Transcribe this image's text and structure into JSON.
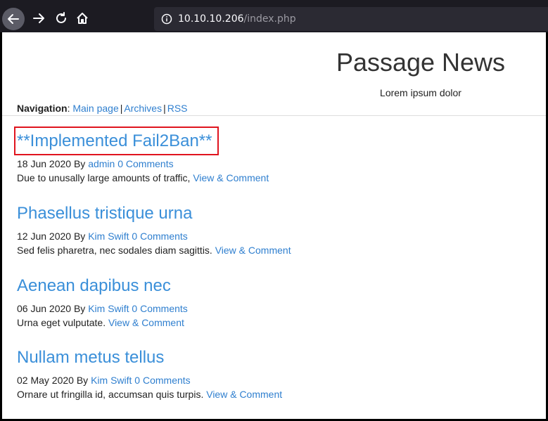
{
  "browser": {
    "url_host": "10.10.10.206",
    "url_path": "/index.php"
  },
  "site": {
    "title": "Passage News",
    "subtitle": "Lorem ipsum dolor",
    "nav_label": "Navigation",
    "nav_links": [
      "Main page",
      "Archives",
      "RSS"
    ]
  },
  "posts": [
    {
      "title": "**Implemented Fail2Ban**",
      "date": "18 Jun 2020 By",
      "author": "admin",
      "comments": "0 Comments",
      "excerpt": "Due to unusally large amounts of traffic,",
      "link": "View & Comment"
    },
    {
      "title": "Phasellus tristique urna",
      "date": "12 Jun 2020 By",
      "author": "Kim Swift",
      "comments": "0 Comments",
      "excerpt": "Sed felis pharetra, nec sodales diam sagittis.",
      "link": "View & Comment"
    },
    {
      "title": "Aenean dapibus nec",
      "date": "06 Jun 2020 By",
      "author": "Kim Swift",
      "comments": "0 Comments",
      "excerpt": "Urna eget vulputate.",
      "link": "View & Comment"
    },
    {
      "title": "Nullam metus tellus",
      "date": "02 May 2020 By",
      "author": "Kim Swift",
      "comments": "0 Comments",
      "excerpt": "Ornare ut fringilla id, accumsan quis turpis.",
      "link": "View & Comment"
    }
  ],
  "colors": {
    "link": "#2f7fcf",
    "highlight": "#e0141e"
  }
}
